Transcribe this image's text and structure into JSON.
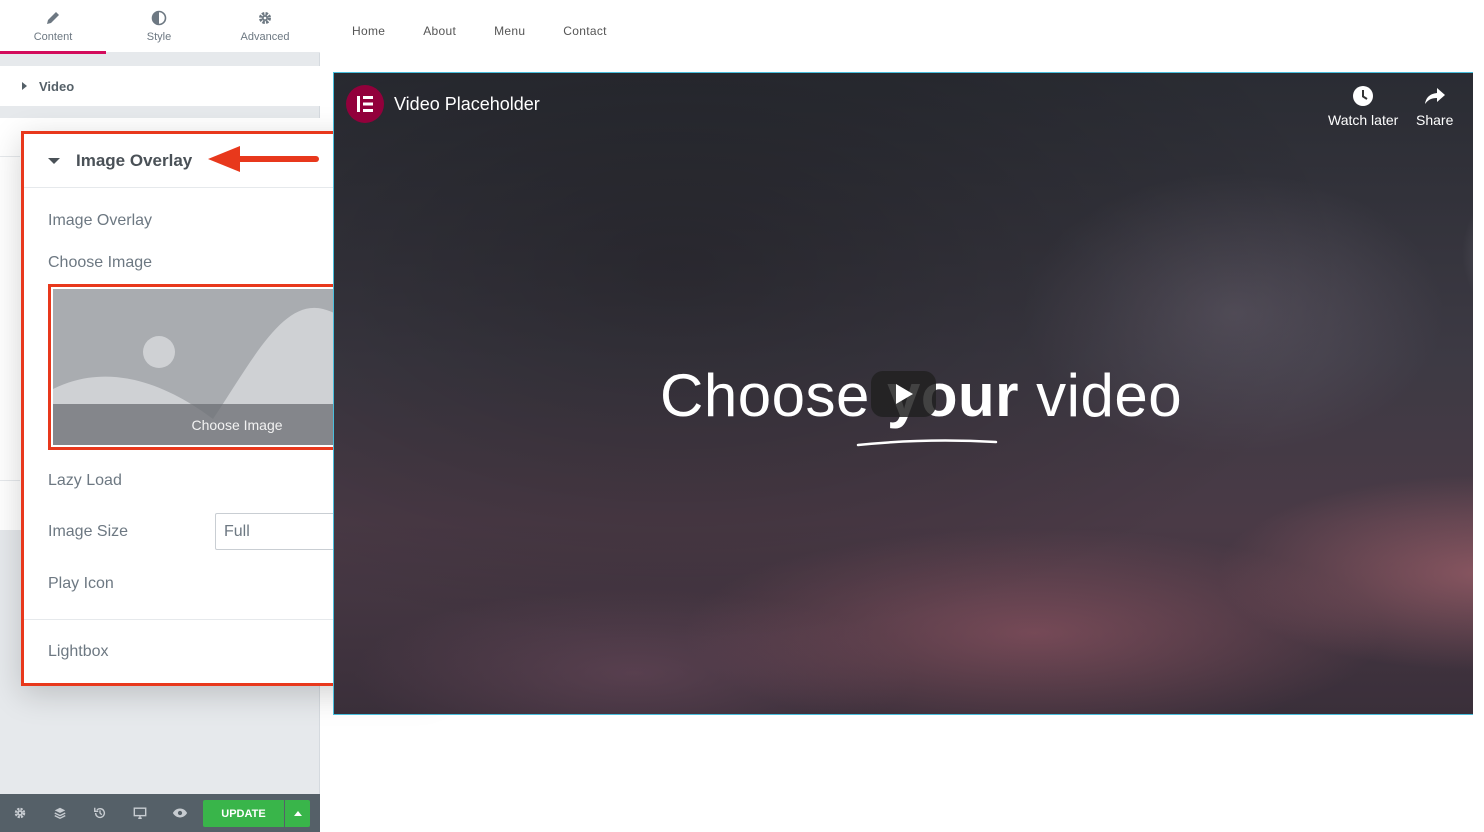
{
  "panel": {
    "tabs": [
      {
        "label": "Content",
        "icon": "pencil-icon",
        "active": true
      },
      {
        "label": "Style",
        "icon": "half-circle-icon",
        "active": false
      },
      {
        "label": "Advanced",
        "icon": "gear-icon",
        "active": false
      }
    ],
    "section_video": {
      "label": "Video"
    },
    "image_overlay": {
      "title": "Image Overlay",
      "image_overlay_toggle": {
        "label": "Image Overlay",
        "state": "SHOW"
      },
      "choose_image": {
        "label": "Choose Image",
        "button_label": "Choose Image"
      },
      "lazy_load": {
        "label": "Lazy Load",
        "state": "NO"
      },
      "image_size": {
        "label": "Image Size",
        "value": "Full"
      },
      "play_icon": {
        "label": "Play Icon",
        "state": "YES"
      },
      "lightbox": {
        "label": "Lightbox",
        "state": "OFF"
      }
    },
    "footer": {
      "update_label": "UPDATE"
    }
  },
  "site_nav": [
    "Home",
    "About",
    "Menu",
    "Contact"
  ],
  "video": {
    "title": "Video Placeholder",
    "watch_later": "Watch later",
    "share": "Share",
    "headline_pre": "Choose ",
    "headline_bold": "your",
    "headline_post": " video"
  },
  "colors": {
    "accent_tab": "#d30c5c",
    "annotation_red": "#e8381c",
    "toggle_on": "#5bc0de",
    "update_green": "#39b54a",
    "logo": "#92003b"
  }
}
